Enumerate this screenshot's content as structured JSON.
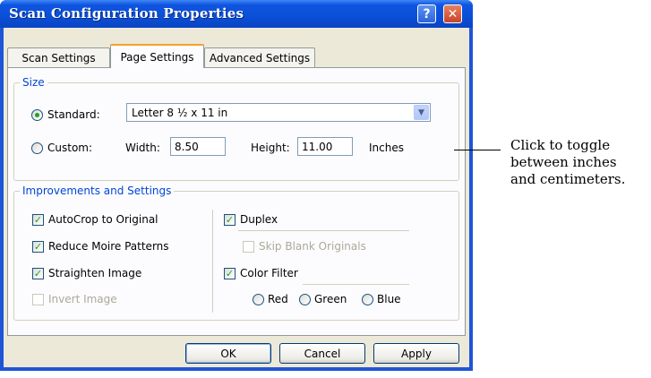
{
  "window": {
    "title": "Scan Configuration Properties",
    "help_glyph": "?",
    "close_glyph": "✕"
  },
  "tabs": [
    {
      "label": "Scan Settings",
      "active": false
    },
    {
      "label": "Page Settings",
      "active": true
    },
    {
      "label": "Advanced Settings",
      "active": false
    }
  ],
  "size": {
    "legend": "Size",
    "standard_label": "Standard:",
    "standard_selected": true,
    "standard_value": "Letter 8 ½ x 11 in",
    "custom_label": "Custom:",
    "custom_selected": false,
    "width_label": "Width:",
    "width_value": "8.50",
    "height_label": "Height:",
    "height_value": "11.00",
    "units_label": "Inches"
  },
  "improvements": {
    "legend": "Improvements and Settings",
    "autocrop": {
      "label": "AutoCrop to Original",
      "checked": true
    },
    "moire": {
      "label": "Reduce Moire Patterns",
      "checked": true
    },
    "straighten": {
      "label": "Straighten Image",
      "checked": true
    },
    "invert": {
      "label": "Invert Image",
      "checked": false,
      "enabled": false
    },
    "duplex": {
      "label": "Duplex",
      "checked": true
    },
    "skip_blank": {
      "label": "Skip Blank Originals",
      "checked": false,
      "enabled": false
    },
    "color_filter": {
      "label": "Color Filter",
      "checked": true
    },
    "filter_options": [
      {
        "label": "Red",
        "selected": false
      },
      {
        "label": "Green",
        "selected": false
      },
      {
        "label": "Blue",
        "selected": false
      }
    ]
  },
  "buttons": {
    "ok": "OK",
    "cancel": "Cancel",
    "apply": "Apply"
  },
  "callout": {
    "line1": "Click to toggle",
    "line2": "between inches",
    "line3": "and centimeters."
  },
  "colors": {
    "title_bar": "#0a4fd6",
    "dialog_face": "#ece9d8",
    "group_legend": "#0046d5",
    "check_mark": "#21a121",
    "active_tab_highlight": "#f6a02b"
  }
}
